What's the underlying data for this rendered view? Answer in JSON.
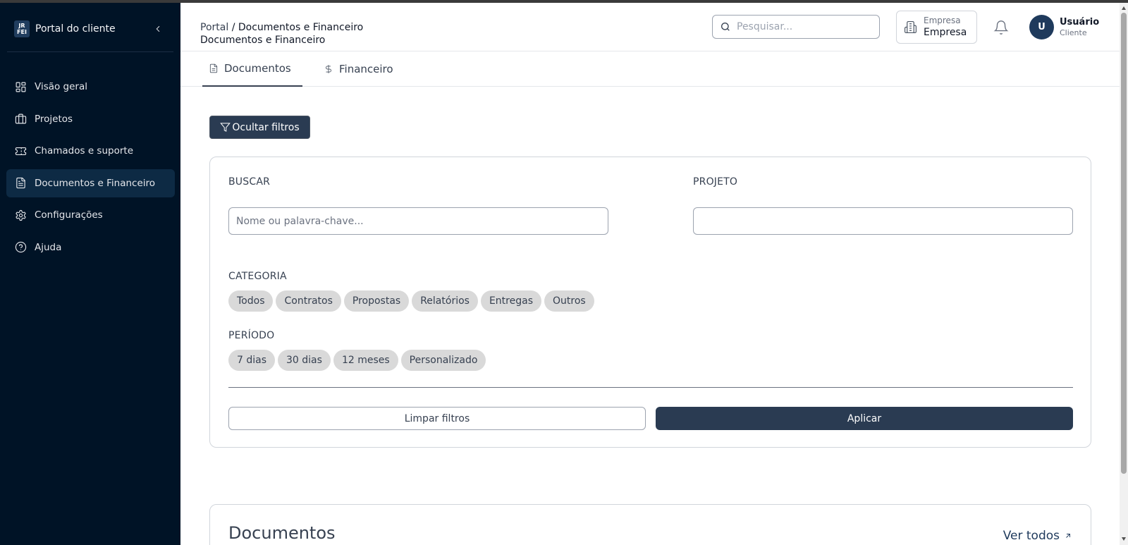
{
  "sidebar": {
    "brand_logo_top": "JR",
    "brand_logo_bottom": "FEI",
    "brand_title": "Portal do cliente",
    "items": [
      {
        "label": "Visão geral",
        "icon": "grid-icon"
      },
      {
        "label": "Projetos",
        "icon": "briefcase-icon"
      },
      {
        "label": "Chamados e suporte",
        "icon": "ticket-icon"
      },
      {
        "label": "Documentos e Financeiro",
        "icon": "file-text-icon",
        "active": true
      },
      {
        "label": "Configurações",
        "icon": "gear-icon"
      },
      {
        "label": "Ajuda",
        "icon": "help-circle-icon"
      }
    ]
  },
  "header": {
    "breadcrumb_root": "Portal",
    "breadcrumb_separator": "/",
    "breadcrumb_current": "Documentos e Financeiro",
    "page_title": "Documentos e Financeiro",
    "search_placeholder": "Pesquisar...",
    "company_label": "Empresa",
    "company_name": "Empresa",
    "user_initial": "U",
    "user_name": "Usuário",
    "user_role": "Cliente"
  },
  "tabs": [
    {
      "label": "Documentos",
      "icon": "file-icon",
      "active": true
    },
    {
      "label": "Financeiro",
      "icon": "dollar-icon",
      "active": false
    }
  ],
  "filters": {
    "toggle_label": "Ocultar filtros",
    "search_label": "BUSCAR",
    "search_placeholder": "Nome ou palavra-chave...",
    "project_label": "PROJETO",
    "project_value": "",
    "category_label": "CATEGORIA",
    "categories": [
      "Todos",
      "Contratos",
      "Propostas",
      "Relatórios",
      "Entregas",
      "Outros"
    ],
    "period_label": "PERÍODO",
    "periods": [
      "7 dias",
      "30 dias",
      "12 meses",
      "Personalizado"
    ],
    "clear_label": "Limpar filtros",
    "apply_label": "Aplicar"
  },
  "documents": {
    "title": "Documentos",
    "view_all_label": "Ver todos"
  },
  "colors": {
    "sidebar_bg": "#001326",
    "sidebar_active_bg": "#0d2a44",
    "primary_button": "#2a3b52",
    "avatar_bg": "#1f3a5c",
    "chip_bg": "#d9d9d9"
  }
}
